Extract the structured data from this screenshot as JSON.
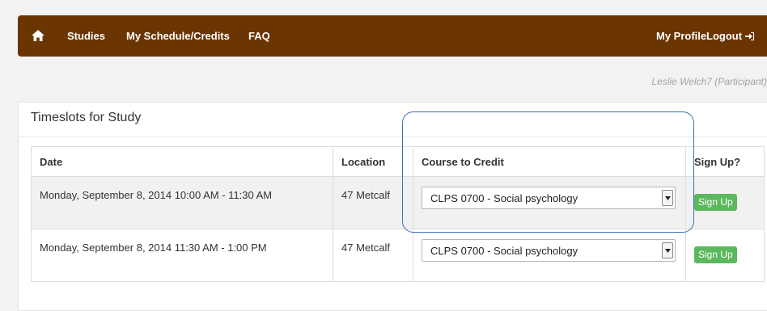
{
  "nav": {
    "studies": "Studies",
    "schedule": "My Schedule/Credits",
    "faq": "FAQ",
    "profile": "My Profile",
    "logout": "Logout"
  },
  "user_line": "Leslie Welch7 (Participant)",
  "panel": {
    "title": "Timeslots for Study",
    "headers": {
      "date": "Date",
      "location": "Location",
      "course": "Course to Credit",
      "signup": "Sign Up?"
    },
    "rows": [
      {
        "date": "Monday, September 8, 2014 10:00 AM - 11:30 AM",
        "location": "47 Metcalf",
        "course": "CLPS 0700 - Social psychology",
        "button": "Sign Up"
      },
      {
        "date": "Monday, September 8, 2014 11:30 AM - 1:00 PM",
        "location": "47 Metcalf",
        "course": "CLPS 0700 - Social psychology",
        "button": "Sign Up"
      }
    ]
  },
  "colors": {
    "navbar": "#6b3502",
    "signup_button": "#5cb85c",
    "highlight": "#3d6fb6"
  }
}
